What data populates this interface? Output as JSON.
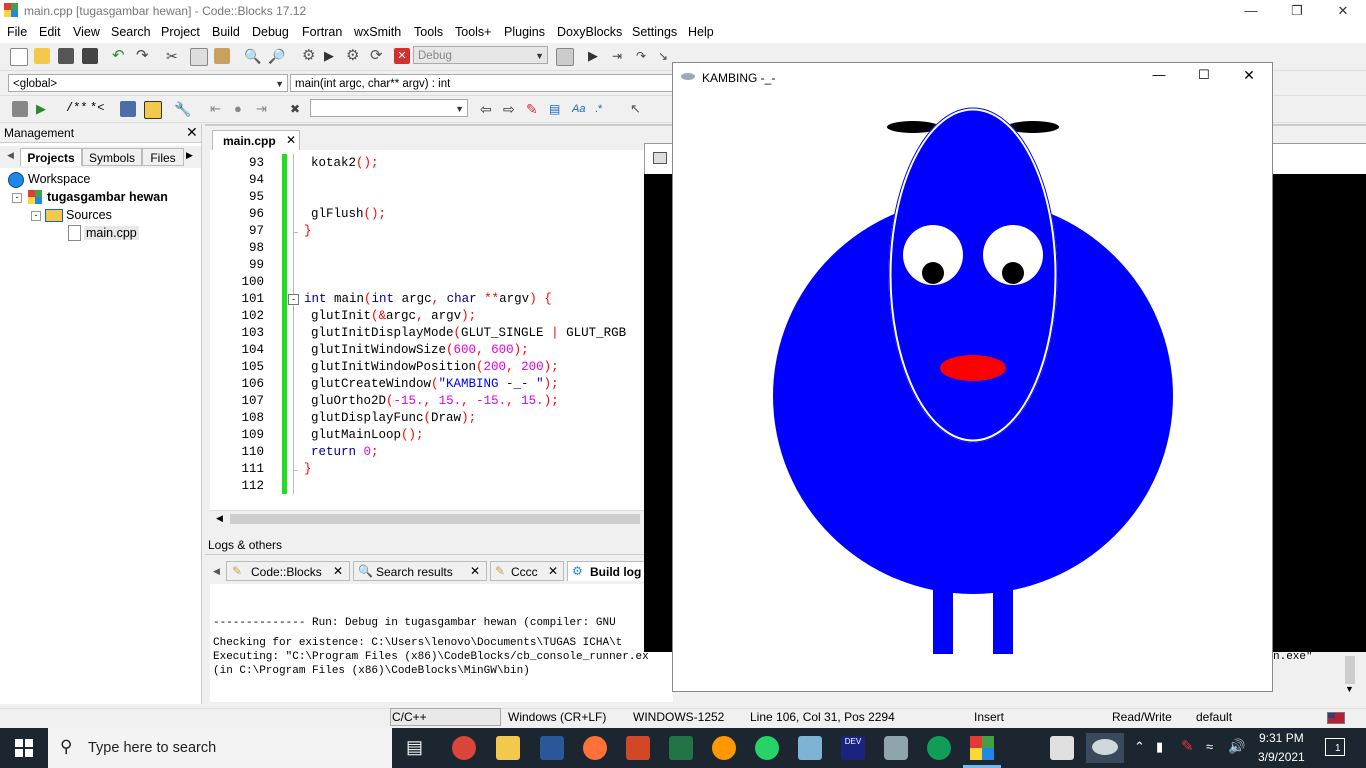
{
  "window": {
    "title": "main.cpp [tugasgambar hewan] - Code::Blocks 17.12"
  },
  "menu": [
    "File",
    "Edit",
    "View",
    "Search",
    "Project",
    "Build",
    "Debug",
    "Fortran",
    "wxSmith",
    "Tools",
    "Tools+",
    "Plugins",
    "DoxyBlocks",
    "Settings",
    "Help"
  ],
  "toolbar": {
    "build_target": "Debug",
    "scope": "<global>",
    "function": "main(int argc, char** argv) : int",
    "doc_comment_1": "/**",
    "doc_comment_2": "*<"
  },
  "management": {
    "title": "Management",
    "tabs": [
      "Projects",
      "Symbols",
      "Files"
    ],
    "tree": {
      "workspace": "Workspace",
      "project": "tugasgambar hewan",
      "folder": "Sources",
      "file": "main.cpp"
    }
  },
  "editor": {
    "tab": "main.cpp",
    "lines": [
      {
        "n": "93",
        "t": "kotak2();"
      },
      {
        "n": "94",
        "t": ""
      },
      {
        "n": "95",
        "t": ""
      },
      {
        "n": "96",
        "t": "glFlush();"
      },
      {
        "n": "97",
        "t": "}"
      },
      {
        "n": "98",
        "t": ""
      },
      {
        "n": "99",
        "t": ""
      },
      {
        "n": "100",
        "t": ""
      },
      {
        "n": "101",
        "t": "int main(int argc, char **argv) {"
      },
      {
        "n": "102",
        "t": "glutInit(&argc, argv);"
      },
      {
        "n": "103",
        "t": "glutInitDisplayMode(GLUT_SINGLE | GLUT_RGB"
      },
      {
        "n": "104",
        "t": "glutInitWindowSize(600, 600);"
      },
      {
        "n": "105",
        "t": "glutInitWindowPosition(200, 200);"
      },
      {
        "n": "106",
        "t": "glutCreateWindow(\"KAMBING -_- \");"
      },
      {
        "n": "107",
        "t": "gluOrtho2D(-15., 15., -15., 15.);"
      },
      {
        "n": "108",
        "t": "glutDisplayFunc(Draw);"
      },
      {
        "n": "109",
        "t": "glutMainLoop();"
      },
      {
        "n": "110",
        "t": "return 0;"
      },
      {
        "n": "111",
        "t": "}"
      },
      {
        "n": "112",
        "t": ""
      }
    ]
  },
  "logs": {
    "title": "Logs & others",
    "tabs": [
      "Code::Blocks",
      "Search results",
      "Cccc",
      "Build log"
    ],
    "lines": [
      "-------------- Run: Debug in tugasgambar hewan (compiler: GNU",
      "Checking for existence: C:\\Users\\lenovo\\Documents\\TUGAS ICHA\\t",
      "Executing: \"C:\\Program Files (x86)\\CodeBlocks/cb_console_runner.ex",
      "(in C:\\Program Files (x86)\\CodeBlocks\\MinGW\\bin)"
    ],
    "exe_tail": "n.exe\""
  },
  "status": {
    "lang": "C/C++",
    "eol": "Windows (CR+LF)",
    "encoding": "WINDOWS-1252",
    "position": "Line 106, Col 31, Pos 2294",
    "mode": "Insert",
    "access": "Read/Write",
    "profile": "default"
  },
  "glut_window": {
    "title": "KAMBING -_-"
  },
  "taskbar": {
    "search_placeholder": "Type here to search",
    "time": "9:31 PM",
    "date": "3/9/2021",
    "notifications": "1"
  },
  "colors": {
    "sheep_blue": "#0000ff",
    "nose_red": "#ff0000",
    "gutter_green": "#22dd22",
    "taskbar": "#1b2631"
  }
}
